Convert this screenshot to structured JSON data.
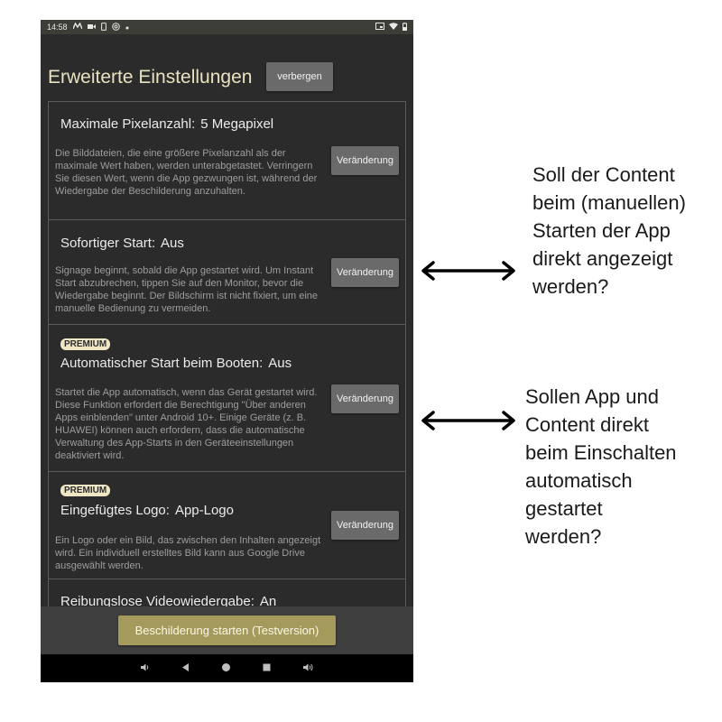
{
  "status_bar": {
    "time": "14:58",
    "left_icons": [
      "mail-icon",
      "video-icon",
      "phone-icon",
      "at-icon",
      "dot-icon"
    ],
    "right_icons": [
      "cast-icon",
      "wifi-icon",
      "battery-icon"
    ]
  },
  "header": {
    "title": "Erweiterte Einstellungen",
    "hide_label": "verbergen"
  },
  "settings": [
    {
      "title": "Maximale Pixelanzahl:",
      "value": "5  Megapixel",
      "premium": false,
      "description": "Die Bilddateien, die eine größere Pixelanzahl als der maximale Wert haben, werden unterabgetastet. Verringern Sie diesen Wert, wenn die App gezwungen ist, während der Wiedergabe der Beschilderung anzuhalten.",
      "button_label": "Veränderung"
    },
    {
      "title": "Sofortiger Start:",
      "value": "Aus",
      "premium": false,
      "description": "Signage beginnt, sobald die App gestartet wird. Um Instant Start abzubrechen, tippen Sie auf den Monitor, bevor die Wiedergabe beginnt. Der Bildschirm ist nicht fixiert, um eine manuelle Bedienung zu vermeiden.",
      "button_label": "Veränderung"
    },
    {
      "title": "Automatischer Start beim Booten:",
      "value": "Aus",
      "premium": true,
      "badge": "PREMIUM",
      "description": "Startet die App automatisch, wenn das Gerät gestartet wird. Diese Funktion erfordert die Berechtigung \"Über anderen Apps einblenden\" unter Android 10+. Einige Geräte (z. B. HUAWEI) können auch erfordern, dass die automatische Verwaltung des App-Starts in den Geräteeinstellungen deaktiviert wird.",
      "button_label": "Veränderung"
    },
    {
      "title": "Eingefügtes Logo:",
      "value": "App-Logo",
      "premium": true,
      "badge": "PREMIUM",
      "description": "Ein Logo oder ein Bild, das zwischen den Inhalten angezeigt wird. Ein individuell erstelltes Bild kann aus Google Drive ausgewählt werden.",
      "button_label": "Veränderung"
    },
    {
      "title": "Reibungslose Videowiedergabe:",
      "value": "An"
    }
  ],
  "bottom": {
    "start_label": "Beschilderung starten (Testversion)"
  },
  "nav_bar": {
    "icons": [
      "volume-down-icon",
      "back-icon",
      "home-icon",
      "recents-icon",
      "volume-up-icon"
    ]
  },
  "annotations": [
    {
      "lines": [
        "Soll der Content",
        "beim (manuellen)",
        "Starten der App",
        "direkt angezeigt",
        "werden?"
      ]
    },
    {
      "lines": [
        "Sollen App und",
        "Content direkt",
        "beim Einschalten",
        "automatisch",
        "gestartet",
        "werden?"
      ]
    }
  ],
  "colors": {
    "screen_bg": "#2b2b2b",
    "title": "#e9e2bf",
    "button": "#6a6a6a",
    "start_button": "#a49a5c",
    "premium_badge": "#efe6c3"
  }
}
